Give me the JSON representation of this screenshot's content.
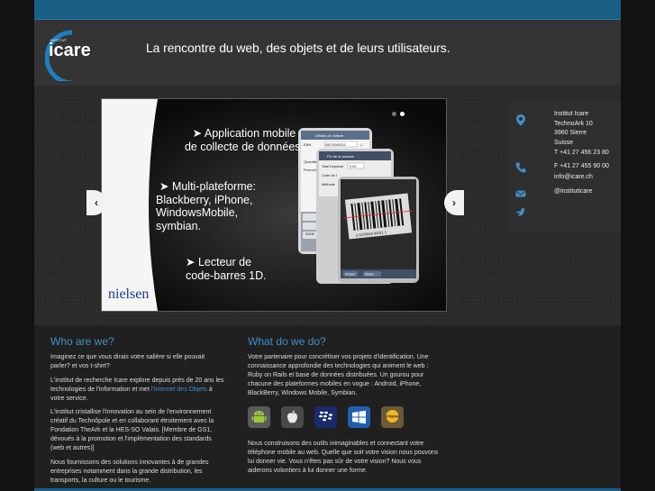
{
  "header": {
    "logo_small": "INSTITUT",
    "logo_name": "icare",
    "tagline": "La rencontre du web, des objets et de leurs utilisateurs."
  },
  "slider": {
    "bullet1_line1": "➤ Application mobile",
    "bullet1_line2": "de collecte de données.",
    "bullet2_line1": "➤ Multi-plateforme:",
    "bullet2_line2": "Blackberry, iPhone,",
    "bullet2_line3": "WindowsMobile,",
    "bullet2_line4": "symbian.",
    "bullet3_line1": "➤ Lecteur de",
    "bullet3_line2": "code-barres 1D.",
    "brand": "nielsen",
    "phone": {
      "tab": "Détails de l'article",
      "ean_label": "EAN",
      "ean_value": "55070000011",
      "session": "Fin de la session",
      "quantite": "Quantité",
      "promotion": "Promotion",
      "total": "Total Dépensé",
      "total_value": "0.00",
      "carte": "Carte de f",
      "methode": "Méthode",
      "done": "DONE",
      "barcode_num": "5 5070000 00011 1",
      "cancel": "Annuler",
      "clear": "Effacer"
    },
    "prev": "‹",
    "next": "›"
  },
  "contact": {
    "name": "Institut Icare",
    "street": "TechnoArk 10",
    "city": "3960 Sierre",
    "country": "Suisse",
    "tel": "T +41 27 456 23 80",
    "fax": "F +41 27 455 90 00",
    "email": "info@icare.ch",
    "twitter": "@instituticare"
  },
  "who": {
    "title": "Who are we?",
    "p1": "Imaginez ce que vous dirais votre salière si elle pouvait parler? et vos t-shirt?",
    "p2_before": "L'institut de recherche Icare explore depuis près de 20 ans les technologies de l'information et met ",
    "p2_link": "l'Internet des Objets",
    "p2_after": " à votre service.",
    "p3": "L'institut cristallise l'innovation au sein de l'environnement créatif du Technôpole et en collaborant étroitement avec la Fondation TheArk et la HES-SO Valais. [Membre de GS1, dévoués à la promotion et l'implémentation des standards (web et autres)]",
    "p4": "Nous fournissons des solutions innovantes à de grandes entreprises notamment dans la grande distribution, les transports, la culture ou le tourisme."
  },
  "what": {
    "title": "What do we do?",
    "p1": "Votre partenaire pour concrétiser vos projets d'identification. Une connaissance approfondie des technologies qui animent le web : Ruby on Rails et base de données distribuées. Un gourou pour chacune des plateformes mobiles en vogue : Android, iPhone, BlackBerry, Windows Mobile, Symbian.",
    "p2": "Nous construisons des outils inimaginables et connectant votre téléphone mobile au web. Quelle que soit votre vision nous pouvons lui donner vie. Vous n'êtes pas sûr de votre vision? Nous vous aiderons volontiers à lui donner une forme.",
    "symbian_label": "SYMBIAN"
  },
  "colors": {
    "accent": "#3f8fc8",
    "topbar": "#1b5e86"
  }
}
